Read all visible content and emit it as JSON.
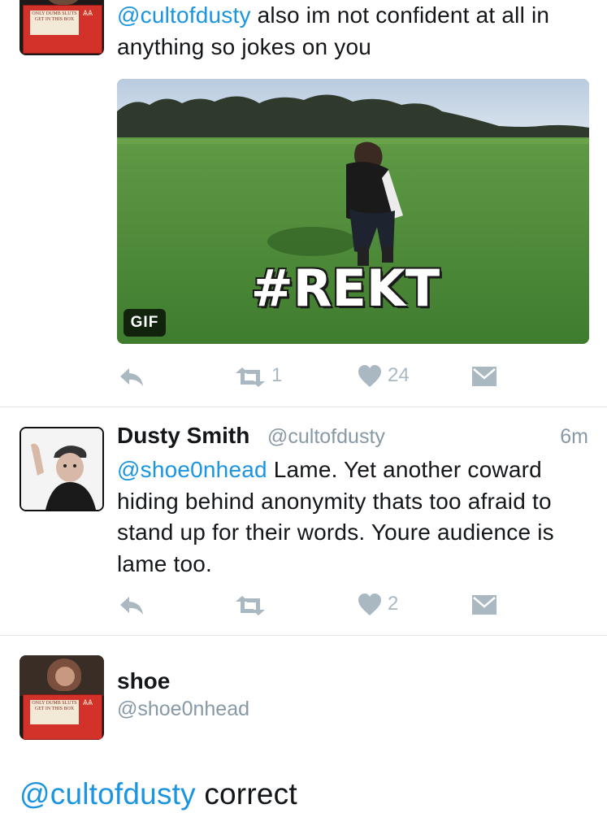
{
  "tweet1": {
    "avatar_sign_text": "ONLY DUMB SLUTS GET IN THIS BOX",
    "mention": "@cultofdusty",
    "text": " also im not confident at all in anything so jokes on you",
    "gif_overlay": "#REKT",
    "gif_badge": "GIF",
    "retweets": "1",
    "likes": "24"
  },
  "tweet2": {
    "name": "Dusty Smith",
    "handle": "@cultofdusty",
    "time": "6m",
    "mention": "@shoe0nhead",
    "text": " Lame. Yet another coward hiding behind anonymity thats too afraid to stand up for their words. Youre audience is lame too.",
    "likes": "2"
  },
  "tweet3": {
    "name": "shoe",
    "handle": "@shoe0nhead",
    "avatar_sign_text": "ONLY DUMB SLUTS GET IN THIS BOX",
    "mention": "@cultofdusty",
    "text": " correct"
  },
  "colors": {
    "accent": "#1b95e0",
    "muted": "#8899a6",
    "icon": "#aab8c2",
    "divider": "#e1e8ed"
  },
  "icons": [
    "reply-icon",
    "retweet-icon",
    "like-icon",
    "direct-message-icon"
  ]
}
